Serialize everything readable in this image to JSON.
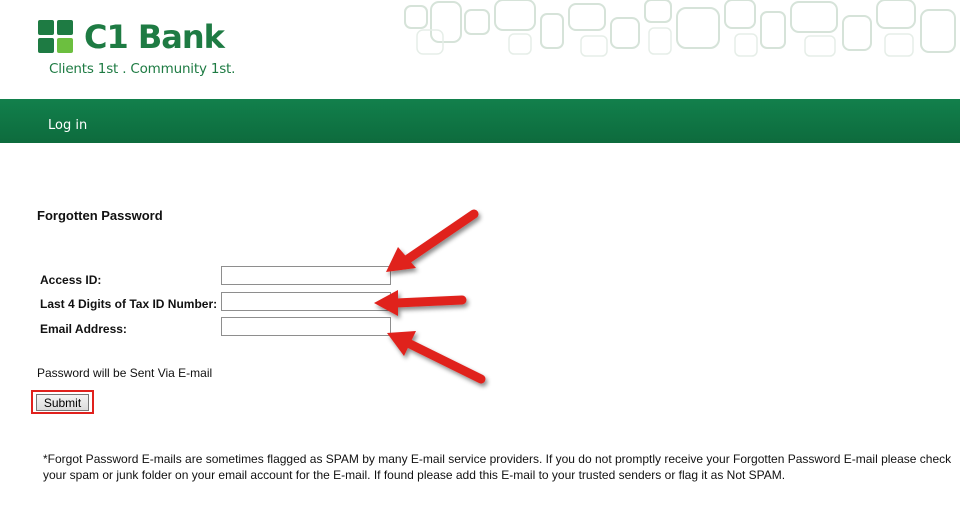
{
  "brand": {
    "name": "C1 Bank",
    "tagline": "Clients 1st . Community 1st.",
    "color": "#1e7b43"
  },
  "nav": {
    "login_label": "Log in",
    "bar_color": "#0f7645"
  },
  "form": {
    "title": "Forgotten Password",
    "fields": [
      {
        "label": "Access ID:",
        "value": ""
      },
      {
        "label": "Last 4 Digits of Tax ID Number:",
        "value": ""
      },
      {
        "label": "Email Address:",
        "value": ""
      }
    ],
    "note": "Password will be Sent Via E-mail",
    "submit_label": "Submit"
  },
  "disclaimer": "*Forgot Password E-mails are sometimes flagged as SPAM by many E-mail service providers. If you do not promptly receive your Forgotten Password E-mail please check your spam or junk folder on your email account for the E-mail. If found please add this E-mail to your trusted senders or flag it as Not SPAM.",
  "annotations": {
    "arrow_color": "#e0211d",
    "highlight": "submit-button"
  }
}
